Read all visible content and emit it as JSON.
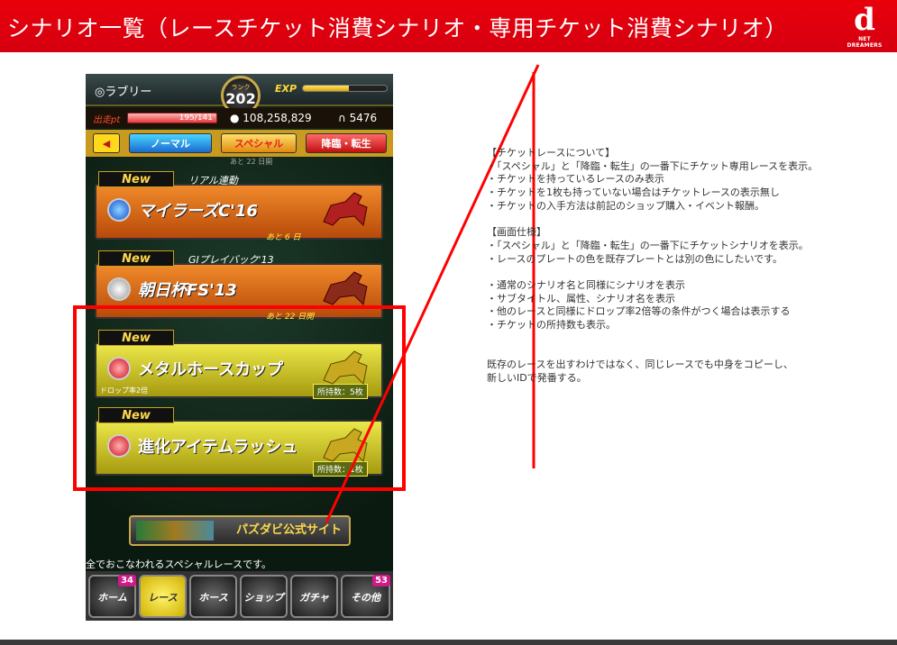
{
  "header": {
    "title": "シナリオ一覧（レースチケット消費シナリオ・専用チケット消費シナリオ）",
    "logo_text": "NET DREAMERS",
    "logo_mark": "d",
    "color": "#e8000b"
  },
  "phone": {
    "status": {
      "name": "◎ラブリー",
      "rank_label": "ランク",
      "rank": "202",
      "exp_label": "EXP",
      "exp_fraction": 0.55,
      "pt_label": "出走pt",
      "pt_value": "195/141",
      "money": "108,258,829",
      "tickets": "5476"
    },
    "tabs": {
      "back": "◀",
      "normal": "ノーマル",
      "special": "スペシャル",
      "kourin": "降臨・転生"
    },
    "cut_text": "あと 22 日開",
    "races": [
      {
        "new": "New",
        "sub": "リアル連動",
        "name": "マイラーズC'16",
        "days": "あと 6 日",
        "orb": "blue",
        "drop": "",
        "owned": ""
      },
      {
        "new": "New",
        "sub": "GIプレイバック'13",
        "name": "朝日杯FS'13",
        "days": "あと 22 日開",
        "orb": "white",
        "drop": "",
        "owned": ""
      },
      {
        "new": "New",
        "sub": "",
        "name": "メタルホースカップ",
        "days": "",
        "orb": "red",
        "drop": "ドロップ率2倍",
        "owned": "所持数：5枚"
      },
      {
        "new": "New",
        "sub": "",
        "name": "進化アイテムラッシュ",
        "days": "",
        "orb": "red",
        "drop": "",
        "owned": "所持数：1枚"
      }
    ],
    "banner": "パズダビ公式サイト",
    "ticker": "全でおこなわれるスペシャルレースです。",
    "nav": [
      {
        "label": "ホーム",
        "badge": "34"
      },
      {
        "label": "レース",
        "badge": ""
      },
      {
        "label": "ホース",
        "badge": ""
      },
      {
        "label": "ショップ",
        "badge": ""
      },
      {
        "label": "ガチャ",
        "badge": ""
      },
      {
        "label": "その他",
        "badge": "53"
      }
    ]
  },
  "notes": [
    "【チケットレースについて】",
    "・「スペシャル」と「降臨・転生」の一番下にチケット専用レースを表示。",
    "・チケットを持っているレースのみ表示",
    "・チケットを1枚も持っていない場合はチケットレースの表示無し",
    "・チケットの入手方法は前記のショップ購入・イベント報酬。",
    "",
    "【画面仕様】",
    "・「スペシャル」と「降臨・転生」の一番下にチケットシナリオを表示。",
    "・レースのプレートの色を既存プレートとは別の色にしたいです。",
    "",
    "・通常のシナリオ名と同様にシナリオを表示",
    "・サブタイトル、属性、シナリオ名を表示",
    "・他のレースと同様にドロップ率2倍等の条件がつく場合は表示する",
    "・チケットの所持数も表示。",
    "",
    "",
    "既存のレースを出すわけではなく、同じレースでも中身をコピーし、",
    "新しいIDで発番する。"
  ],
  "annotation_color": "#ff0000"
}
